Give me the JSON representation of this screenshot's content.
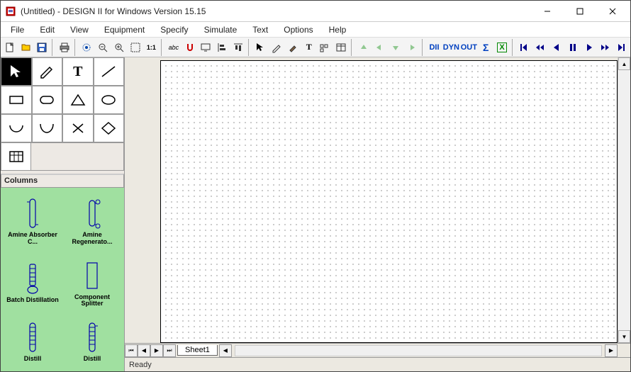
{
  "title": "(Untitled) - DESIGN II for Windows Version 15.15",
  "menus": [
    "File",
    "Edit",
    "View",
    "Equipment",
    "Specify",
    "Simulate",
    "Text",
    "Options",
    "Help"
  ],
  "toolbar_text": {
    "dii": "DII",
    "dyn": "DYN",
    "out": "OUT",
    "sigma": "Σ",
    "x": "X"
  },
  "shape_tools": [
    "cursor",
    "pencil",
    "text",
    "line",
    "rectangle",
    "rounded-rect",
    "triangle",
    "ellipse",
    "arc",
    "curve",
    "cross",
    "diamond"
  ],
  "extra_tool": "table",
  "section_header": "Columns",
  "equipment": [
    {
      "name": "amine-absorber",
      "label": "Amine Absorber C..."
    },
    {
      "name": "amine-regenerator",
      "label": "Amine Regenerato..."
    },
    {
      "name": "batch-distillation",
      "label": "Batch Distillation"
    },
    {
      "name": "component-splitter",
      "label": "Component Splitter"
    },
    {
      "name": "distill-1",
      "label": "Distill"
    },
    {
      "name": "distill-2",
      "label": "Distill"
    }
  ],
  "sheet_tab": "Sheet1",
  "status": "Ready"
}
